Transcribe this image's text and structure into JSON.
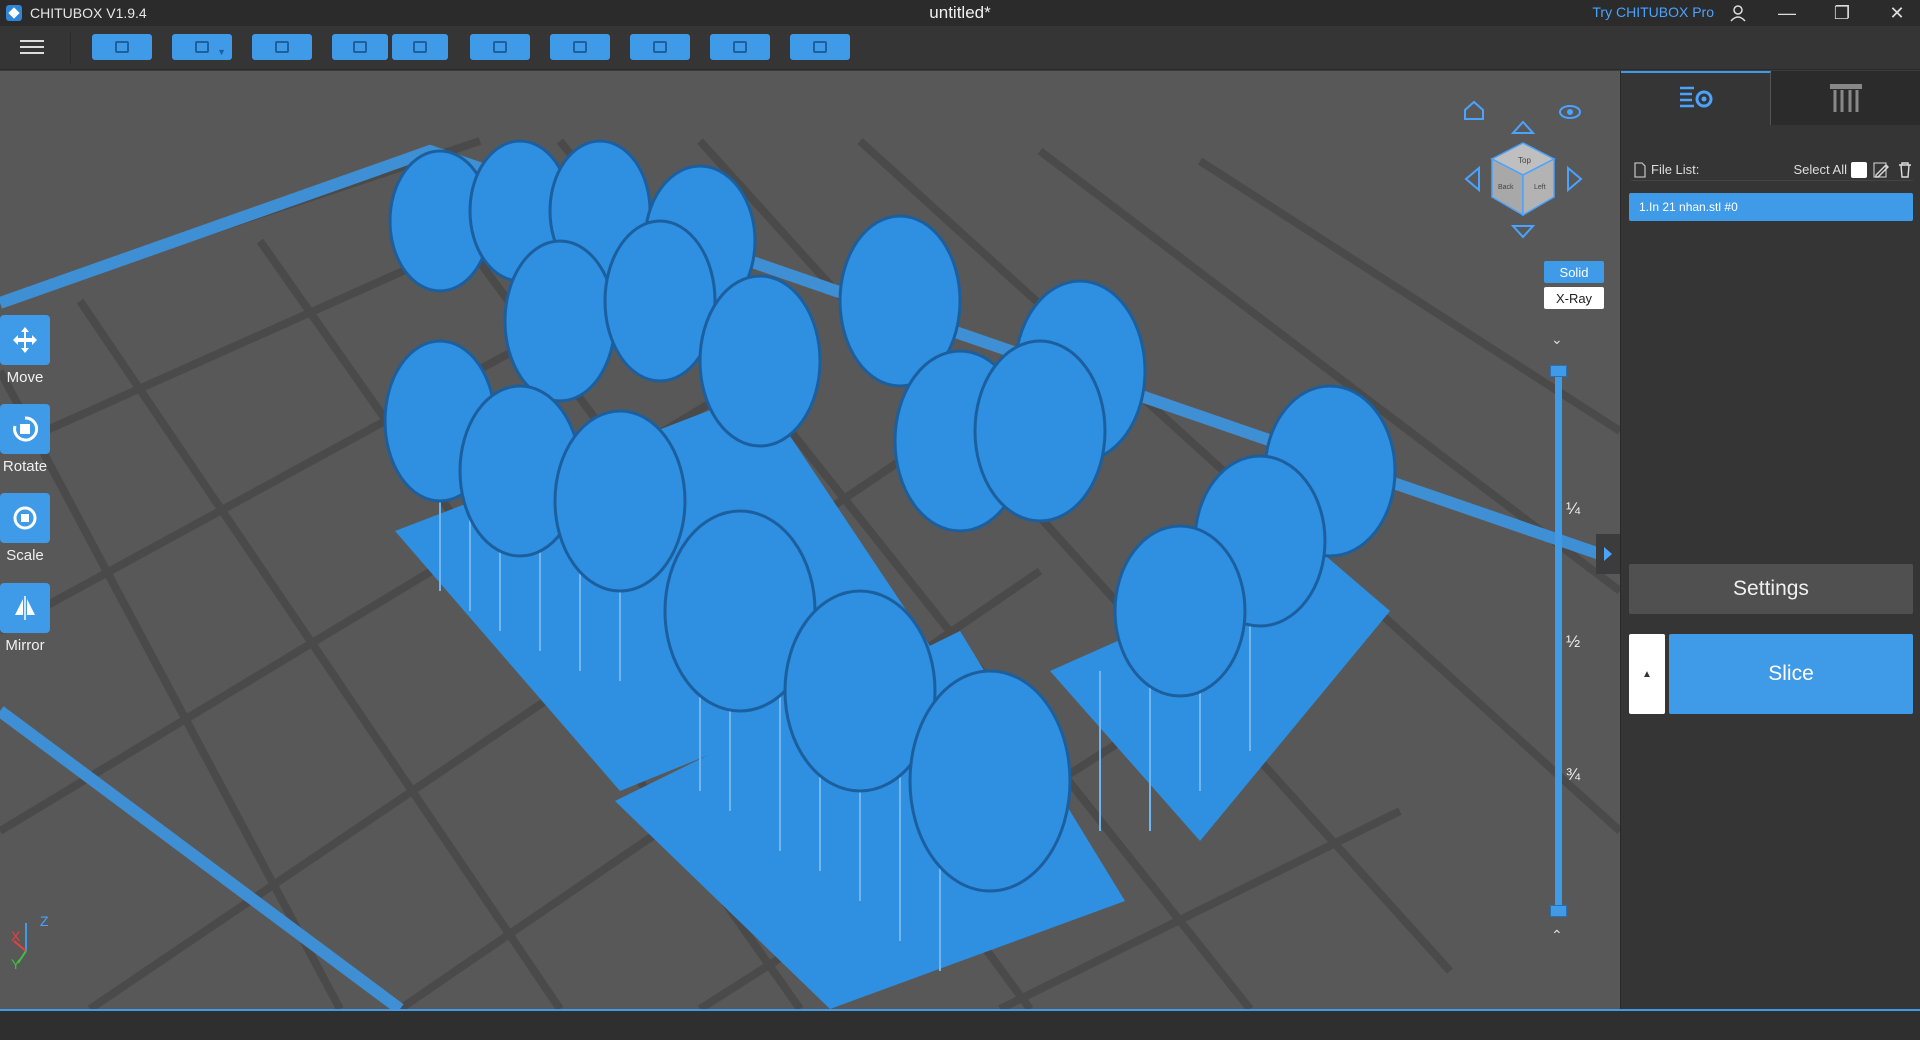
{
  "titlebar": {
    "app_name": "CHITUBOX V1.9.4",
    "doc_title": "untitled*",
    "try_pro": "Try CHITUBOX Pro"
  },
  "toolbar": {
    "buttons": [
      "open-file",
      "save",
      "auto-arrange",
      "undo",
      "redo",
      "list",
      "multi-copy",
      "support",
      "hollow",
      "export"
    ]
  },
  "left_tools": [
    {
      "label": "Move",
      "icon": "move-icon"
    },
    {
      "label": "Rotate",
      "icon": "rotate-icon"
    },
    {
      "label": "Scale",
      "icon": "scale-icon"
    },
    {
      "label": "Mirror",
      "icon": "mirror-icon"
    }
  ],
  "view": {
    "solid_label": "Solid",
    "xray_label": "X-Ray",
    "cube_faces": {
      "top": "Top",
      "back": "Back",
      "left": "Left"
    }
  },
  "slider": {
    "tick_quarter": "¼",
    "tick_half": "½",
    "tick_three_quarter": "¾"
  },
  "axes": {
    "x": "X",
    "y": "Y",
    "z": "Z"
  },
  "panel": {
    "file_list_label": "File List:",
    "select_all_label": "Select All",
    "file_item": "1.In 21 nhan.stl #0",
    "settings_label": "Settings",
    "slice_label": "Slice"
  },
  "colors": {
    "accent": "#3f9ae8",
    "viewport_bg": "#585858",
    "panel_bg": "#353535",
    "model": "#2f8fe0"
  }
}
